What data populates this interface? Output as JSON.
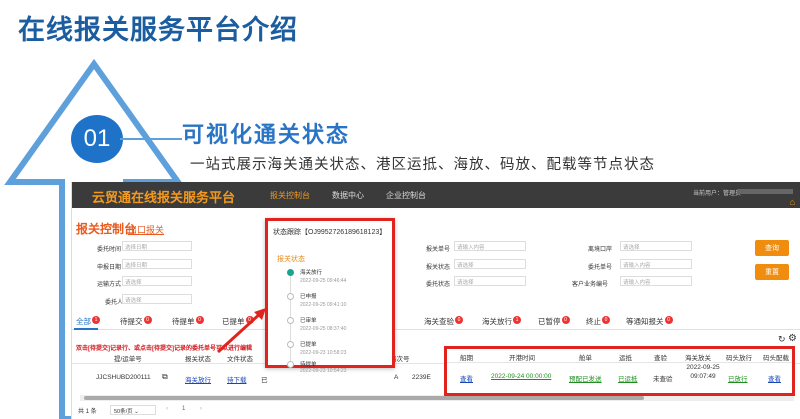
{
  "slide": {
    "title": "在线报关服务平台介绍",
    "number": "01",
    "section_title": "可视化通关状态",
    "section_desc": "一站式展示海关通关状态、港区运抵、海放、码放、配载等节点状态"
  },
  "colors": {
    "brand_blue": "#1b5d9e",
    "accent_orange": "#f39a1e",
    "highlight_red": "#e0241d",
    "topbar": "#3b3b3b"
  },
  "app": {
    "brand": "云贸通在线报关服务平台",
    "nav": [
      "报关控制台",
      "数据中心",
      "企业控制台"
    ],
    "current_user": "当前用户：管理员",
    "home_icon": "home-icon",
    "control_title": "报关控制台",
    "control_sub": "出口报关",
    "filters": [
      {
        "label": "委托时间",
        "placeholder": "选择日期"
      },
      {
        "label": "申报日期",
        "placeholder": "选择日期"
      },
      {
        "label": "运输方式",
        "placeholder": "请选择"
      },
      {
        "label": "委托人",
        "placeholder": "请选择"
      },
      {
        "label": "报关单号",
        "placeholder": "请输入内容"
      },
      {
        "label": "报关状态",
        "placeholder": "请选择"
      },
      {
        "label": "委托状态",
        "placeholder": "请选择"
      },
      {
        "label": "离境口岸",
        "placeholder": "请选择"
      },
      {
        "label": "委托单号",
        "placeholder": "请输入内容"
      },
      {
        "label": "客户业务编号",
        "placeholder": "请输入内容"
      }
    ],
    "query_button": "查询",
    "reset_button": "重置",
    "tabs": [
      {
        "label": "全部",
        "count": "1"
      },
      {
        "label": "待提交",
        "count": "0"
      },
      {
        "label": "待提单",
        "count": "0"
      },
      {
        "label": "已提单",
        "count": "0"
      },
      {
        "label": "海关查验",
        "count": "0"
      },
      {
        "label": "海关放行",
        "count": "1"
      },
      {
        "label": "已暂停",
        "count": "0"
      },
      {
        "label": "终止",
        "count": "0"
      },
      {
        "label": "等通知报关",
        "count": "0"
      }
    ],
    "hint": "双击[待提交]记录行、或点击[待提交]记录的委托单号可以进行编辑",
    "columns_left": [
      "提/运单号",
      "报关状态",
      "文件状态"
    ],
    "columns_right": [
      "船次号",
      "船期",
      "开港时间",
      "舱单",
      "运抵",
      "查验",
      "海关放关",
      "码头放行",
      "码头配载"
    ],
    "row": {
      "bill_no": "JJCSHUBD200111",
      "customs_status": "海关放行",
      "file_status": "待下载",
      "voyage": "2239E",
      "schedule": "查看",
      "port_open": "2022-09-24 00:00:00",
      "manifest": "预配已发送",
      "arrival": "已运抵",
      "inspection": "未查验",
      "customs_release": "2022-09-25 09:07:49",
      "terminal_release": "已放行",
      "terminal_stowage": "查看",
      "partial_a": "A",
      "partial_b": "已"
    },
    "footer": {
      "total": "共 1 条",
      "page_size": "50条/页",
      "page": "1"
    },
    "refresh_icon": "refresh-icon",
    "settings_icon": "gear-icon"
  },
  "status_popup": {
    "title": "状态跟踪【OJ995272618961812​3】",
    "status_label": "报关状态",
    "steps": [
      {
        "name": "海关放行",
        "time": "2022-09-25 09:46:44"
      },
      {
        "name": "已申报",
        "time": "2022-09-25 09:41:10"
      },
      {
        "name": "已审单",
        "time": "2022-09-25 08:37:40"
      },
      {
        "name": "已提单",
        "time": "2022-09-23 10:58:23"
      },
      {
        "name": "待提单",
        "time": "2022-09-23 10:54:23"
      }
    ]
  }
}
